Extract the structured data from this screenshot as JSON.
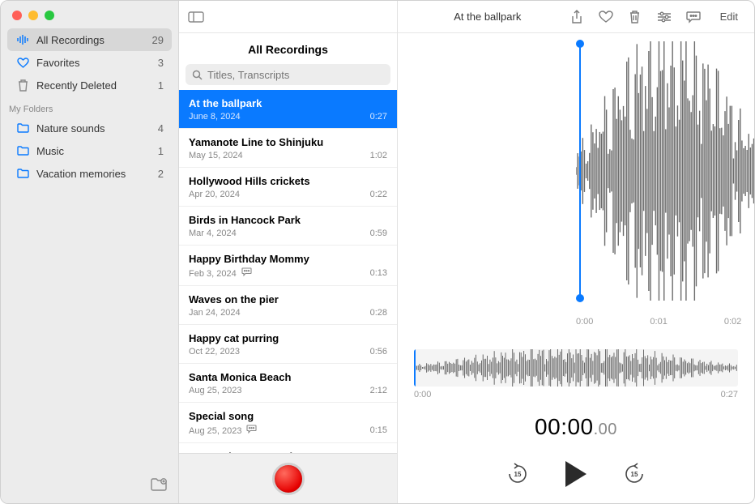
{
  "sidebar": {
    "system": [
      {
        "icon": "waveform",
        "label": "All Recordings",
        "count": "29",
        "selected": true
      },
      {
        "icon": "heart",
        "label": "Favorites",
        "count": "3"
      },
      {
        "icon": "trash",
        "label": "Recently Deleted",
        "count": "1"
      }
    ],
    "folders_header": "My Folders",
    "folders": [
      {
        "label": "Nature sounds",
        "count": "4"
      },
      {
        "label": "Music",
        "count": "1"
      },
      {
        "label": "Vacation memories",
        "count": "2"
      }
    ]
  },
  "mid": {
    "title": "All Recordings",
    "search_placeholder": "Titles, Transcripts",
    "recordings": [
      {
        "title": "At the ballpark",
        "date": "June 8, 2024",
        "dur": "0:27",
        "selected": true
      },
      {
        "title": "Yamanote Line to Shinjuku",
        "date": "May 15, 2024",
        "dur": "1:02"
      },
      {
        "title": "Hollywood Hills crickets",
        "date": "Apr 20, 2024",
        "dur": "0:22"
      },
      {
        "title": "Birds in Hancock Park",
        "date": "Mar 4, 2024",
        "dur": "0:59"
      },
      {
        "title": "Happy Birthday Mommy",
        "date": "Feb 3, 2024",
        "dur": "0:13",
        "transcript": true
      },
      {
        "title": "Waves on the pier",
        "date": "Jan 24, 2024",
        "dur": "0:28"
      },
      {
        "title": "Happy cat purring",
        "date": "Oct 22, 2023",
        "dur": "0:56"
      },
      {
        "title": "Santa Monica Beach",
        "date": "Aug 25, 2023",
        "dur": "2:12"
      },
      {
        "title": "Special song",
        "date": "Aug 25, 2023",
        "dur": "0:15",
        "transcript": true
      },
      {
        "title": "Parrots in Buenos Aires",
        "date": "",
        "dur": ""
      }
    ]
  },
  "detail": {
    "title": "At the ballpark",
    "edit_label": "Edit",
    "ruler": [
      "0:00",
      "0:01",
      "0:02"
    ],
    "mini_start": "0:00",
    "mini_end": "0:27",
    "big_time_main": "00:00",
    "big_time_frac": ".00",
    "skip_amount": "15"
  }
}
